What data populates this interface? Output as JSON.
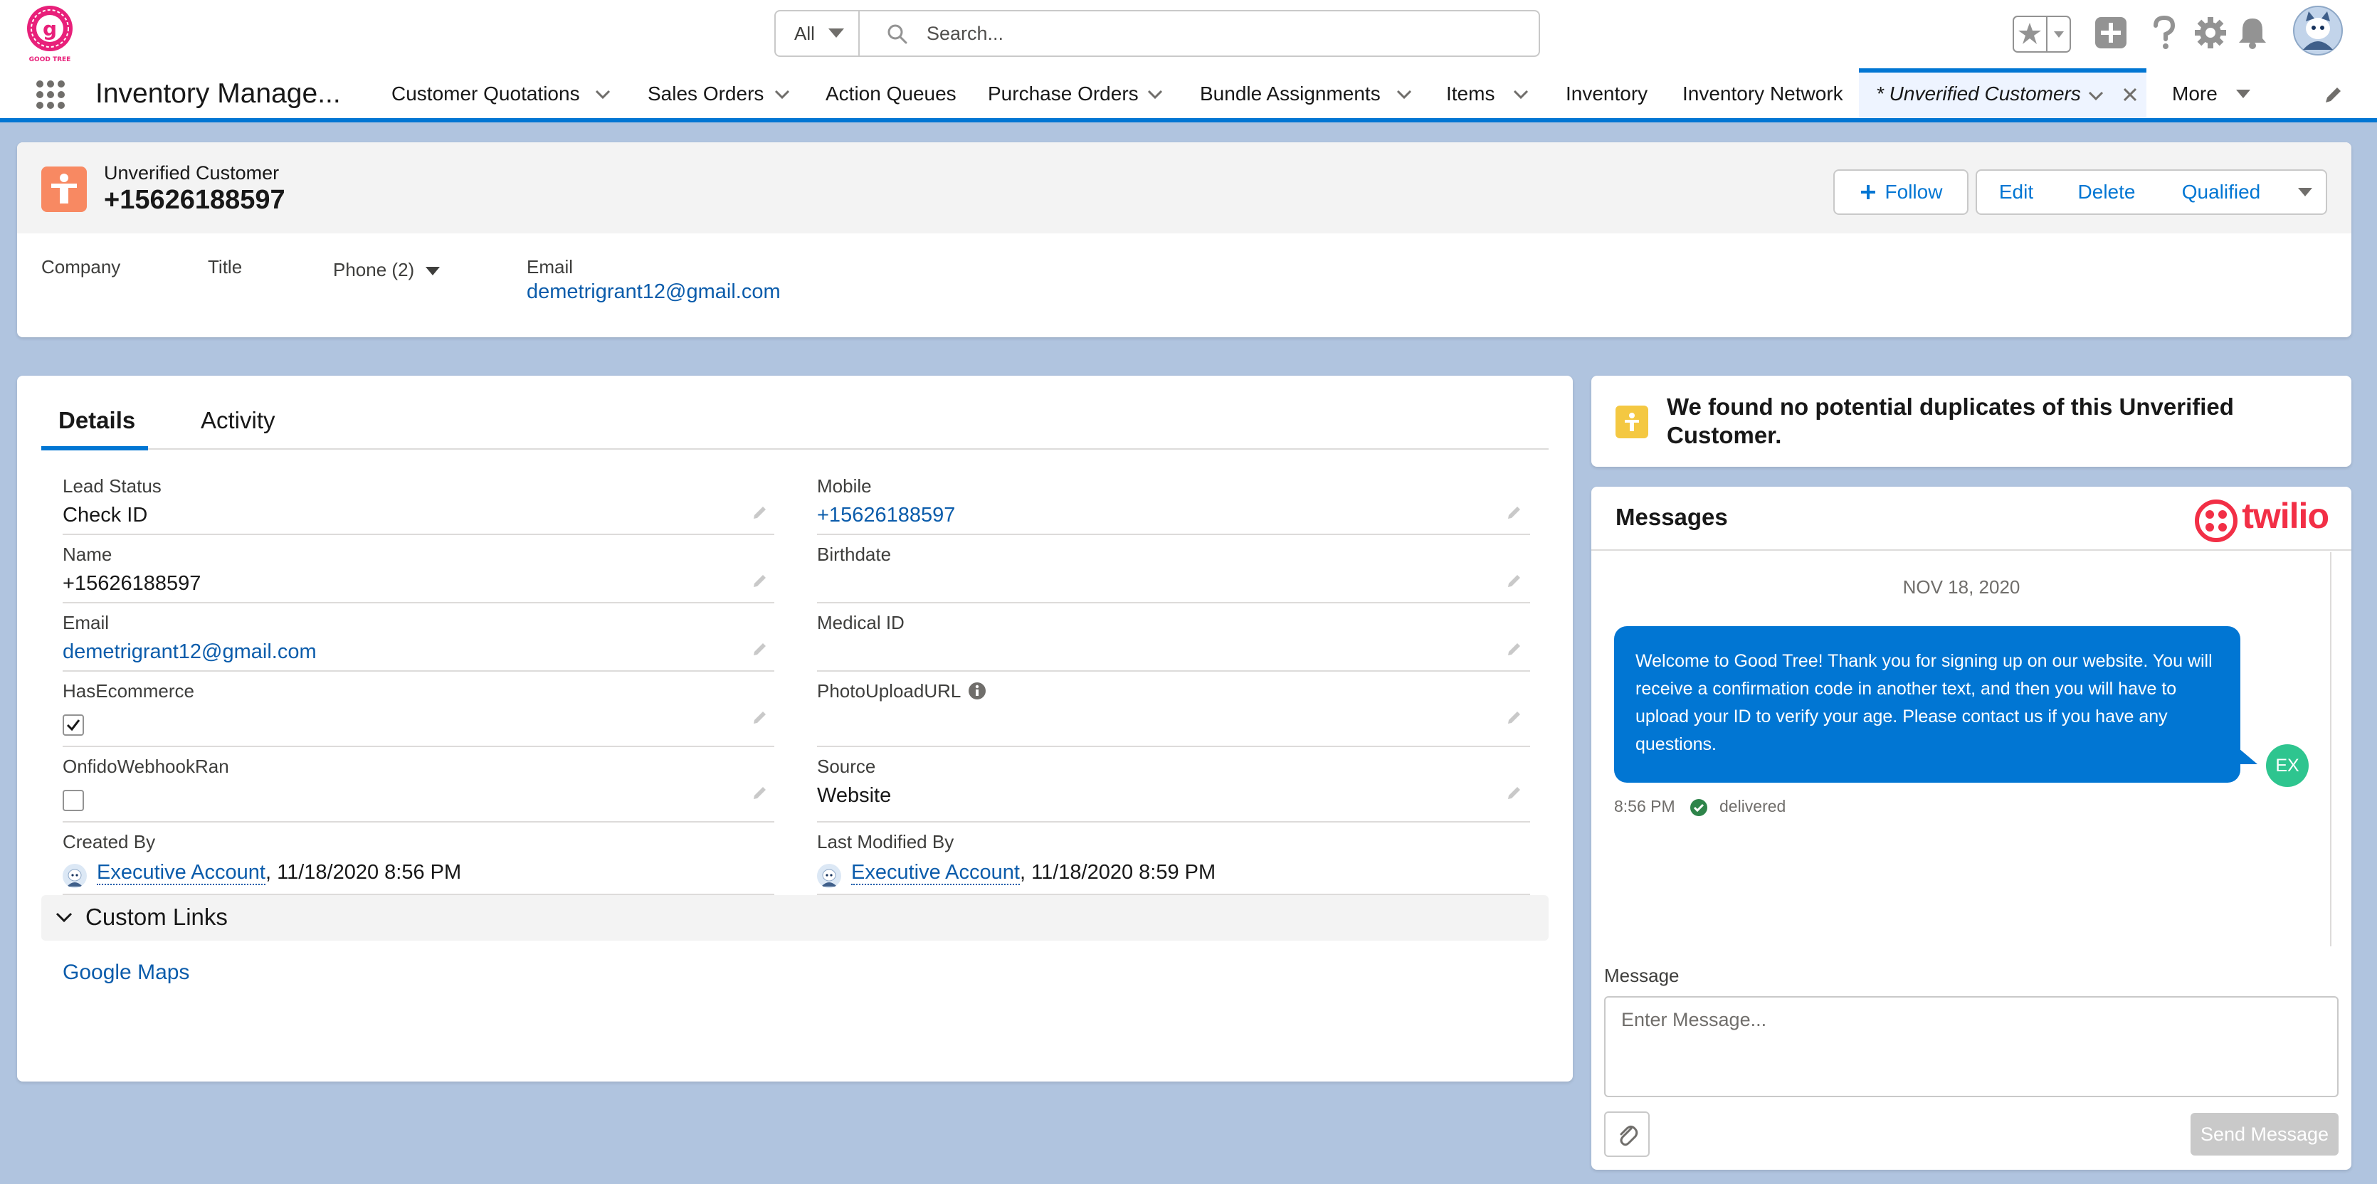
{
  "brand": {
    "logo_letter": "g",
    "logo_caption": "GOOD TREE"
  },
  "search": {
    "scope": "All",
    "placeholder": "Search..."
  },
  "nav": {
    "app_name": "Inventory Manage...",
    "items": [
      {
        "label": "Customer Quotations",
        "has_menu": true
      },
      {
        "label": "Sales Orders",
        "has_menu": true
      },
      {
        "label": "Action Queues",
        "has_menu": false
      },
      {
        "label": "Purchase Orders",
        "has_menu": true
      },
      {
        "label": "Bundle Assignments",
        "has_menu": true
      },
      {
        "label": "Items",
        "has_menu": true
      },
      {
        "label": "Inventory",
        "has_menu": false
      },
      {
        "label": "Inventory Network",
        "has_menu": false
      }
    ],
    "active_tab": "* Unverified Customers",
    "more": "More"
  },
  "record": {
    "type": "Unverified Customer",
    "title": "+15626188597",
    "actions": {
      "follow": "Follow",
      "edit": "Edit",
      "delete": "Delete",
      "qualified": "Qualified"
    },
    "highlights": {
      "company_label": "Company",
      "title_label": "Title",
      "phone_label": "Phone (2)",
      "email_label": "Email",
      "email_value": "demetrigrant12@gmail.com"
    }
  },
  "tabs": {
    "details": "Details",
    "activity": "Activity"
  },
  "fields": {
    "lead_status": {
      "label": "Lead Status",
      "value": "Check ID"
    },
    "mobile": {
      "label": "Mobile",
      "value": "+15626188597"
    },
    "name": {
      "label": "Name",
      "value": "+15626188597"
    },
    "birthdate": {
      "label": "Birthdate",
      "value": ""
    },
    "email": {
      "label": "Email",
      "value": "demetrigrant12@gmail.com"
    },
    "medical_id": {
      "label": "Medical ID",
      "value": ""
    },
    "has_ecommerce": {
      "label": "HasEcommerce",
      "checked": true
    },
    "photo_upload_url": {
      "label": "PhotoUploadURL",
      "value": ""
    },
    "onfido_webhook_ran": {
      "label": "OnfidoWebhookRan",
      "checked": false
    },
    "source": {
      "label": "Source",
      "value": "Website"
    },
    "created_by": {
      "label": "Created By",
      "user": "Executive Account",
      "date": ", 11/18/2020 8:56 PM"
    },
    "last_modified_by": {
      "label": "Last Modified By",
      "user": "Executive Account",
      "date": ", 11/18/2020 8:59 PM"
    }
  },
  "custom_links": {
    "title": "Custom Links",
    "links": [
      "Google Maps"
    ]
  },
  "duplicates": {
    "text": "We found no potential duplicates of this Unverified Customer."
  },
  "messages": {
    "title": "Messages",
    "logo_text": "twilio",
    "date": "NOV 18, 2020",
    "items": [
      {
        "text": "Welcome to Good Tree! Thank you for signing up on our website. You will receive a confirmation code in another text, and then you will have to upload your ID to verify your age. Please contact us if you have any questions.",
        "sender_initials": "EX",
        "time": "8:56 PM",
        "status": "delivered"
      }
    ],
    "compose_label": "Message",
    "compose_placeholder": "Enter Message...",
    "send_label": "Send Message"
  },
  "colors": {
    "brand_blue": "#0176d3",
    "link_blue": "#0b5cab",
    "record_icon": "#f88962",
    "duplicates_icon": "#f4c842",
    "twilio_red": "#f22f46",
    "delivered_green": "#2e844a",
    "avatar_green": "#2ec58f",
    "logo_pink": "#e8207a"
  },
  "icons": [
    "search-icon",
    "favorites-star-icon",
    "add-icon",
    "help-icon",
    "setup-gear-icon",
    "notifications-bell-icon",
    "app-launcher-icon",
    "chevron-down-icon",
    "close-icon",
    "pencil-icon",
    "info-icon",
    "paperclip-icon",
    "check-circle-icon"
  ]
}
